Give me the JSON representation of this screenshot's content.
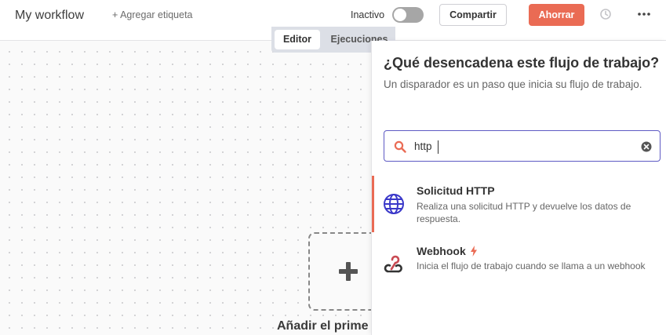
{
  "header": {
    "workflow_name": "My workflow",
    "add_tag": "+ Agregar etiqueta",
    "status_label": "Inactivo",
    "share_label": "Compartir",
    "save_label": "Ahorrar"
  },
  "tabs": [
    {
      "label": "Editor",
      "active": true
    },
    {
      "label": "Ejecuciones",
      "active": false
    }
  ],
  "canvas": {
    "add_first_step_label": "Añadir el prime"
  },
  "panel": {
    "title": "¿Qué desencadena este flujo de trabajo?",
    "subtitle": "Un disparador es un paso que inicia su flujo de trabajo.",
    "search": {
      "value": "http",
      "placeholder": ""
    },
    "nodes": [
      {
        "name": "Solicitud HTTP",
        "description": "Realiza una solicitud HTTP y devuelve los datos de respuesta.",
        "icon": "globe-icon",
        "selected": true
      },
      {
        "name": "Webhook",
        "description": "Inicia el flujo de trabajo cuando se llama a un webhook",
        "icon": "webhook-icon",
        "trigger_icon": "bolt-icon",
        "selected": false
      }
    ]
  },
  "colors": {
    "accent": "#ea6b54",
    "search_border": "#5e5ac4",
    "globe": "#3a38c9",
    "webhook_red": "#c94a53"
  }
}
